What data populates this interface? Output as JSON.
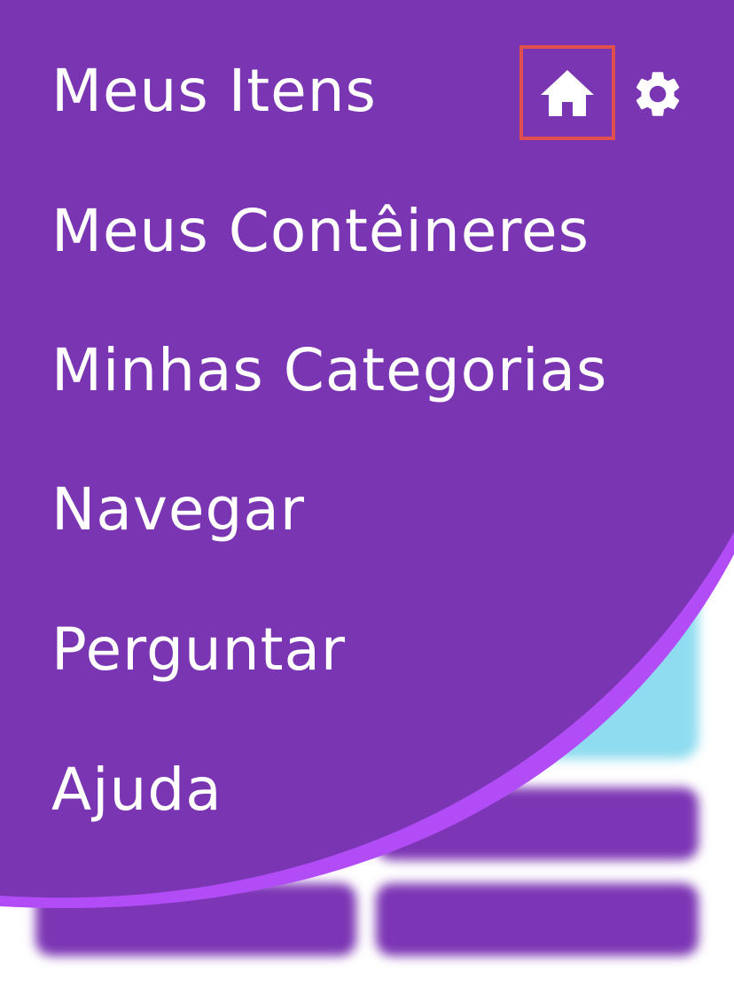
{
  "drawer": {
    "menu": [
      {
        "label": "Meus Itens"
      },
      {
        "label": "Meus Contêineres"
      },
      {
        "label": "Minhas Categorias"
      },
      {
        "label": "Navegar"
      },
      {
        "label": "Perguntar"
      },
      {
        "label": "Ajuda"
      }
    ],
    "icons": {
      "home": "home-icon",
      "settings": "gear-icon"
    }
  },
  "colors": {
    "drawer_purple": "#7a35b2",
    "accent_purple": "#b14cf7",
    "highlight_red": "#e0504f",
    "background_card": "#8fdcf0",
    "text": "#ffffff"
  }
}
